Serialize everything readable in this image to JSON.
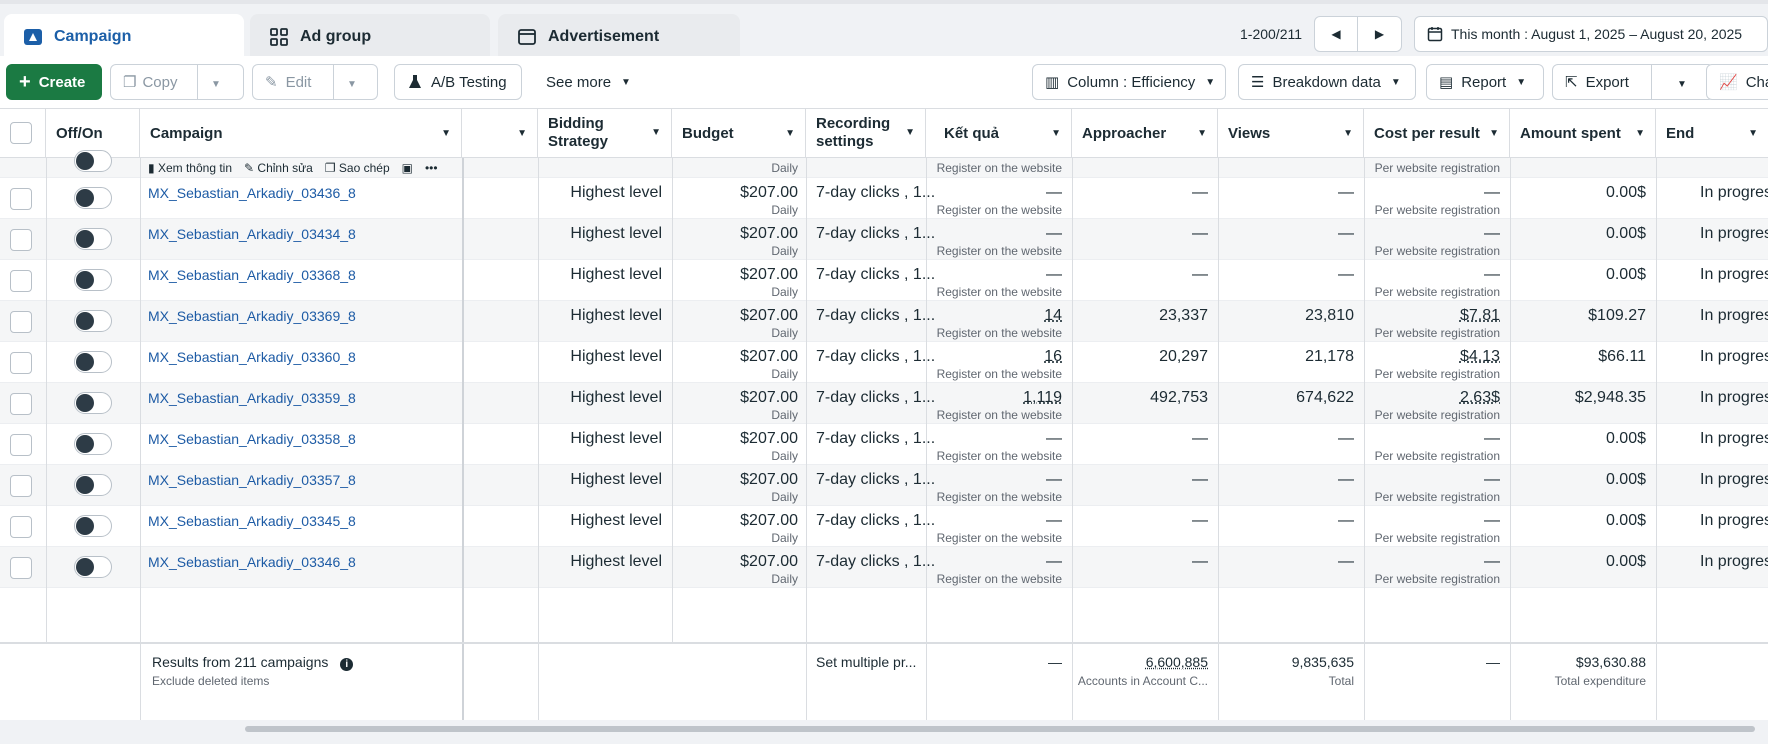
{
  "tabs": [
    {
      "label": "Campaign",
      "active": true
    },
    {
      "label": "Ad group",
      "active": false
    },
    {
      "label": "Advertisement",
      "active": false
    }
  ],
  "pager": {
    "range": "1-200/211"
  },
  "date_range": "This month : August 1, 2025 – August 20, 2025",
  "toolbar": {
    "create": "Create",
    "copy": "Copy",
    "edit": "Edit",
    "ab_testing": "A/B Testing",
    "see_more": "See more",
    "column": "Column : Efficiency",
    "breakdown": "Breakdown data",
    "report": "Report",
    "export": "Export",
    "chart": "Chart"
  },
  "columns": {
    "off_on": "Off/On",
    "campaign": "Campaign",
    "bidding": "Bidding Strategy",
    "budget": "Budget",
    "recording": "Recording settings",
    "result": "Kết quả",
    "approacher": "Approacher",
    "views": "Views",
    "cost_per_result": "Cost per result",
    "amount_spent": "Amount spent",
    "end": "End"
  },
  "hover_row": {
    "actions": [
      "Xem thông tin",
      "Chỉnh sửa",
      "Sao chép"
    ],
    "budget_sub": "Daily",
    "result_sub": "Register on the website",
    "cost_sub": "Per website registration"
  },
  "rows": [
    {
      "name": "MX_Sebastian_Arkadiy_03436_8",
      "bidding": "Highest level",
      "budget": "$207.00",
      "budget_sub": "Daily",
      "recording": "7-day clicks , 1...",
      "result": "—",
      "result_sub": "Register on the website",
      "approacher": "—",
      "views": "—",
      "cost": "—",
      "cost_sub": "Per website registration",
      "spent": "0.00$",
      "end": "In progress"
    },
    {
      "name": "MX_Sebastian_Arkadiy_03434_8",
      "bidding": "Highest level",
      "budget": "$207.00",
      "budget_sub": "Daily",
      "recording": "7-day clicks , 1...",
      "result": "—",
      "result_sub": "Register on the website",
      "approacher": "—",
      "views": "—",
      "cost": "—",
      "cost_sub": "Per website registration",
      "spent": "0.00$",
      "end": "In progress"
    },
    {
      "name": "MX_Sebastian_Arkadiy_03368_8",
      "bidding": "Highest level",
      "budget": "$207.00",
      "budget_sub": "Daily",
      "recording": "7-day clicks , 1...",
      "result": "—",
      "result_sub": "Register on the website",
      "approacher": "—",
      "views": "—",
      "cost": "—",
      "cost_sub": "Per website registration",
      "spent": "0.00$",
      "end": "In progress"
    },
    {
      "name": "MX_Sebastian_Arkadiy_03369_8",
      "bidding": "Highest level",
      "budget": "$207.00",
      "budget_sub": "Daily",
      "recording": "7-day clicks , 1...",
      "result": "14",
      "result_sub": "Register on the website",
      "approacher": "23,337",
      "views": "23,810",
      "cost": "$7.81",
      "cost_sub": "Per website registration",
      "spent": "$109.27",
      "end": "In progress"
    },
    {
      "name": "MX_Sebastian_Arkadiy_03360_8",
      "bidding": "Highest level",
      "budget": "$207.00",
      "budget_sub": "Daily",
      "recording": "7-day clicks , 1...",
      "result": "16",
      "result_sub": "Register on the website",
      "approacher": "20,297",
      "views": "21,178",
      "cost": "$4.13",
      "cost_sub": "Per website registration",
      "spent": "$66.11",
      "end": "In progress"
    },
    {
      "name": "MX_Sebastian_Arkadiy_03359_8",
      "bidding": "Highest level",
      "budget": "$207.00",
      "budget_sub": "Daily",
      "recording": "7-day clicks , 1...",
      "result": "1,119",
      "result_sub": "Register on the website",
      "approacher": "492,753",
      "views": "674,622",
      "cost": "2.63$",
      "cost_sub": "Per website registration",
      "spent": "$2,948.35",
      "end": "In progress"
    },
    {
      "name": "MX_Sebastian_Arkadiy_03358_8",
      "bidding": "Highest level",
      "budget": "$207.00",
      "budget_sub": "Daily",
      "recording": "7-day clicks , 1...",
      "result": "—",
      "result_sub": "Register on the website",
      "approacher": "—",
      "views": "—",
      "cost": "—",
      "cost_sub": "Per website registration",
      "spent": "0.00$",
      "end": "In progress"
    },
    {
      "name": "MX_Sebastian_Arkadiy_03357_8",
      "bidding": "Highest level",
      "budget": "$207.00",
      "budget_sub": "Daily",
      "recording": "7-day clicks , 1...",
      "result": "—",
      "result_sub": "Register on the website",
      "approacher": "—",
      "views": "—",
      "cost": "—",
      "cost_sub": "Per website registration",
      "spent": "0.00$",
      "end": "In progress"
    },
    {
      "name": "MX_Sebastian_Arkadiy_03345_8",
      "bidding": "Highest level",
      "budget": "$207.00",
      "budget_sub": "Daily",
      "recording": "7-day clicks , 1...",
      "result": "—",
      "result_sub": "Register on the website",
      "approacher": "—",
      "views": "—",
      "cost": "—",
      "cost_sub": "Per website registration",
      "spent": "0.00$",
      "end": "In progress"
    },
    {
      "name": "MX_Sebastian_Arkadiy_03346_8",
      "bidding": "Highest level",
      "budget": "$207.00",
      "budget_sub": "Daily",
      "recording": "7-day clicks , 1...",
      "result": "—",
      "result_sub": "Register on the website",
      "approacher": "—",
      "views": "—",
      "cost": "—",
      "cost_sub": "Per website registration",
      "spent": "0.00$",
      "end": "In progress"
    }
  ],
  "footer": {
    "title": "Results from 211 campaigns",
    "subtitle": "Exclude deleted items",
    "recording": "Set multiple pr...",
    "result": "—",
    "approacher": "6,600,885",
    "approacher_sub": "Accounts in Account C...",
    "views": "9,835,635",
    "views_sub": "Total",
    "cost": "—",
    "spent": "$93,630.88",
    "spent_sub": "Total expenditure"
  },
  "colors": {
    "primary": "#1b7a43",
    "link": "#1d5ba5",
    "active_tab": "#1c5fa8"
  }
}
